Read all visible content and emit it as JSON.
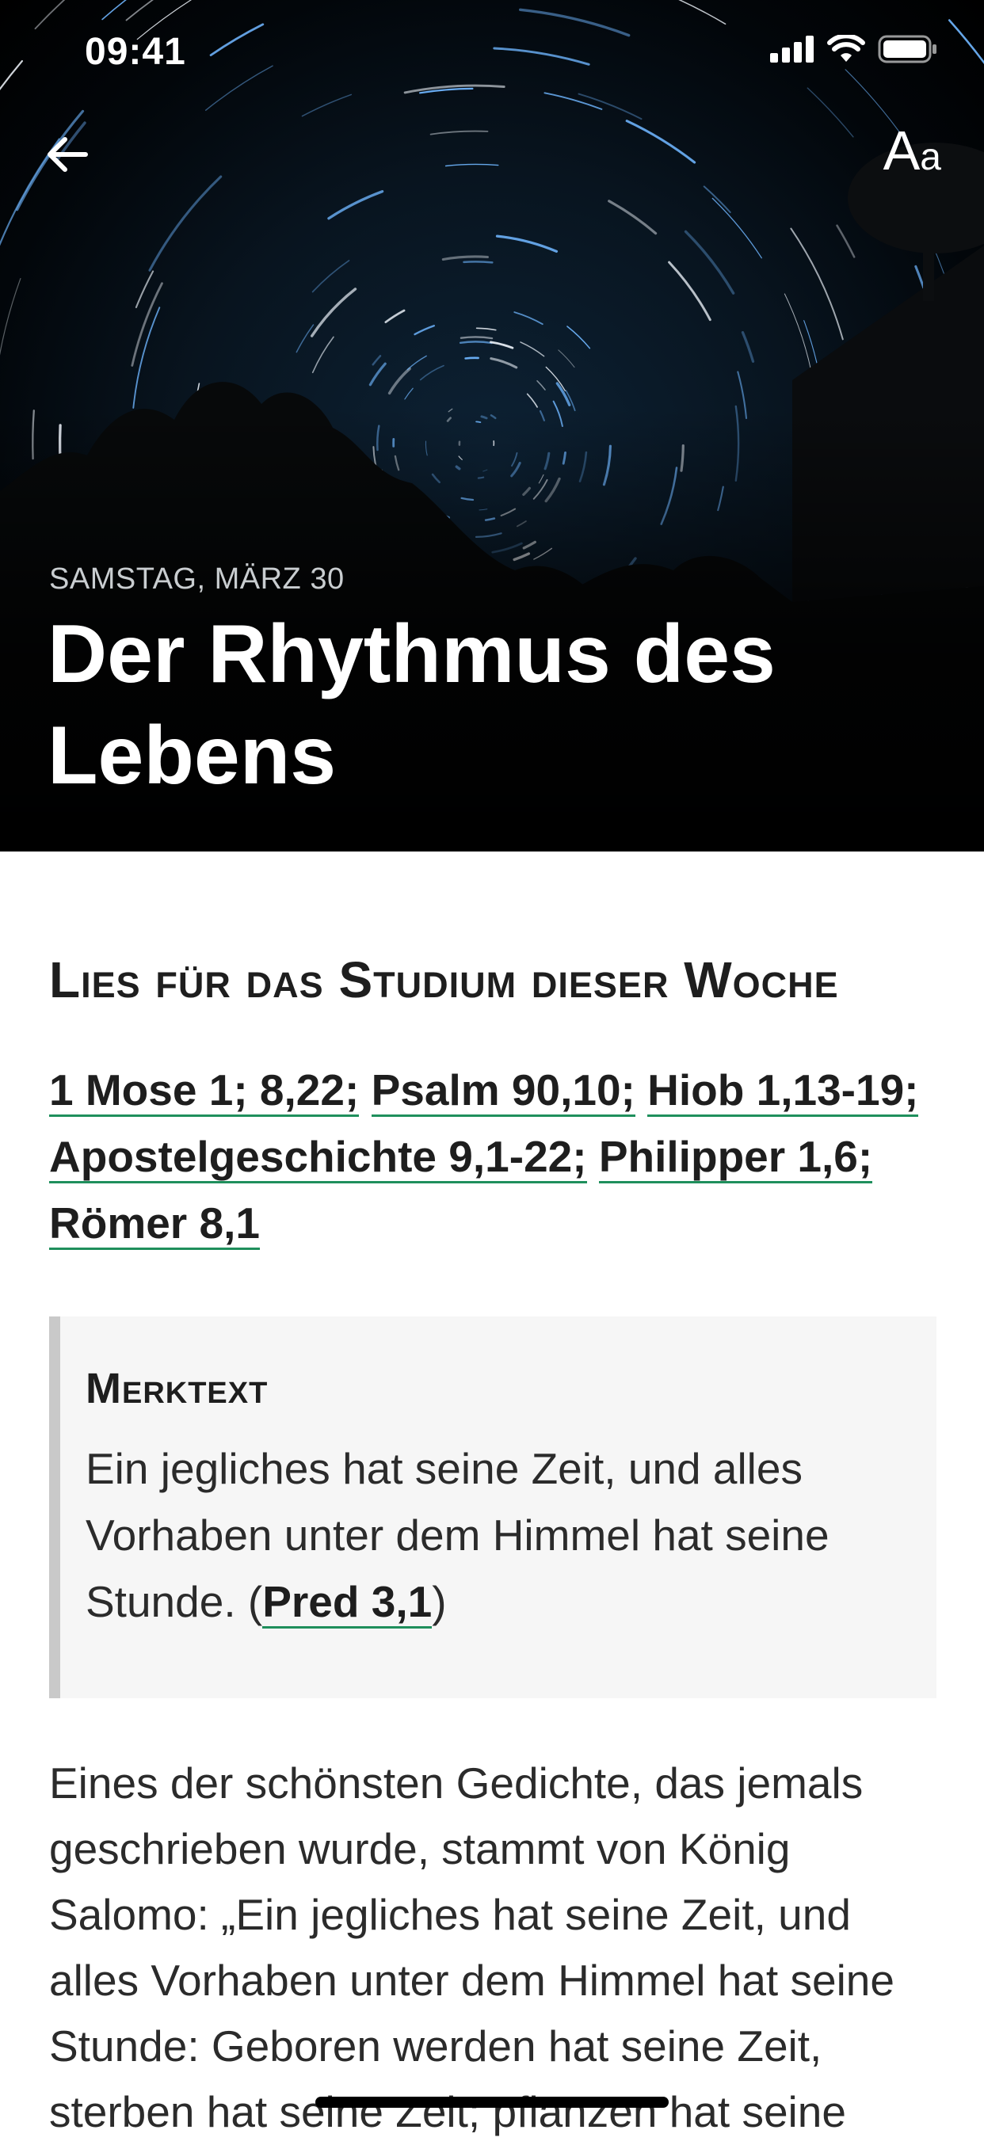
{
  "status_bar": {
    "time": "09:41"
  },
  "header": {
    "date": "SAMSTAG, MÄRZ 30",
    "title": "Der Rhythmus des Lebens",
    "font_button": {
      "large": "A",
      "small": "a"
    },
    "back_icon": "arrow-left-icon"
  },
  "reading": {
    "section_title": "Lies für das Studium dieser Woche",
    "references": [
      "1 Mose 1; 8,22;",
      "Psalm 90,10;",
      "Hiob 1,13-19;",
      "Apostelgeschichte 9,1-22;",
      "Philipper 1,6;",
      "Römer 8,1"
    ]
  },
  "memory_verse": {
    "title": "Merktext",
    "text": "Ein jegliches hat seine Zeit, und alles Vorhaben unter dem Himmel hat seine Stunde. (",
    "reference": "Pred 3,1",
    "closing": ")"
  },
  "body": {
    "paragraph": "Eines der schönsten Gedichte, das jemals geschrieben wurde, stammt von König Salomo: „Ein jegliches hat seine Zeit, und alles Vorhaben unter dem Himmel hat seine Stunde: Geboren werden hat seine Zeit, sterben hat seine Zeit; pflanzen hat seine"
  },
  "colors": {
    "link_underline": "#1f8f5c",
    "hero_background": "#000000",
    "quote_background": "#f6f6f6"
  }
}
